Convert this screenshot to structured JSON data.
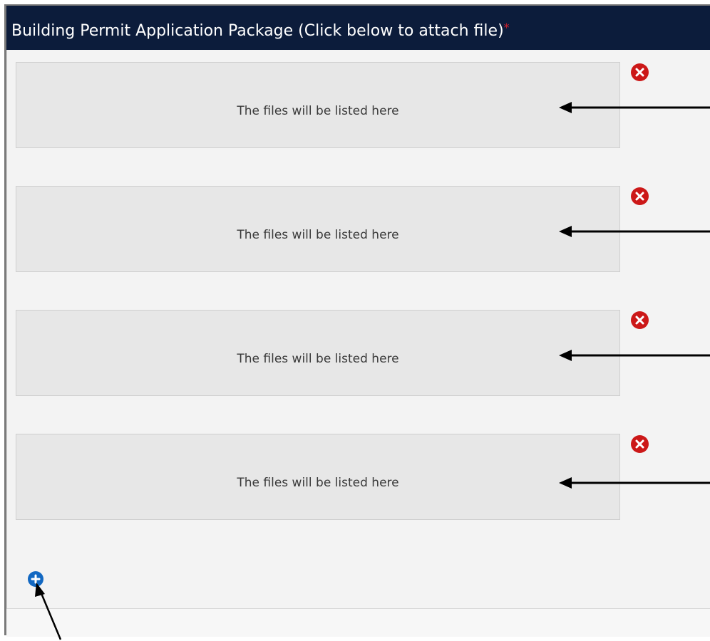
{
  "header": {
    "title": "Building Permit Application Package (Click below to attach file)",
    "required_marker": "*"
  },
  "file_slots": [
    {
      "placeholder": "The files will be listed here"
    },
    {
      "placeholder": "The files will be listed here"
    },
    {
      "placeholder": "The files will be listed here"
    },
    {
      "placeholder": "The files will be listed here"
    }
  ],
  "icons": {
    "remove": "remove-circle-icon",
    "add": "add-circle-icon"
  },
  "colors": {
    "header_bg": "#0c1c3b",
    "required": "#d0202c",
    "remove": "#cc1818",
    "add": "#1268c2"
  }
}
